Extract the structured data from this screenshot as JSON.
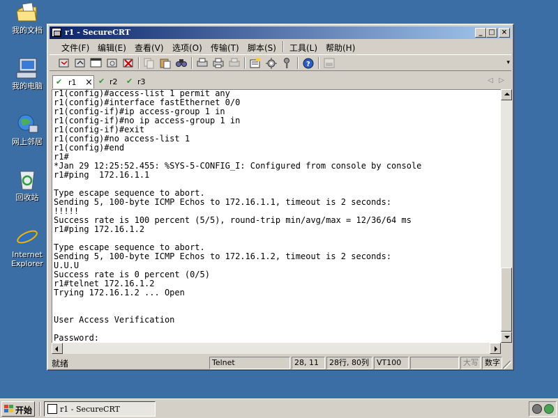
{
  "desktop": {
    "icons": [
      {
        "label": "我的文档",
        "icon": "folder-documents-icon"
      },
      {
        "label": "我的电脑",
        "icon": "computer-icon"
      },
      {
        "label": "网上邻居",
        "icon": "network-icon"
      },
      {
        "label": "回收站",
        "icon": "recycle-bin-icon"
      },
      {
        "label": "Internet Explorer",
        "icon": "internet-explorer-icon"
      }
    ]
  },
  "window": {
    "title": "r1 - SecureCRT",
    "controls": {
      "minimize": "_",
      "maximize": "□",
      "close": "×"
    },
    "menu": [
      "文件(F)",
      "编辑(E)",
      "查看(V)",
      "选项(O)",
      "传输(T)",
      "脚本(S)",
      "工具(L)",
      "帮助(H)"
    ],
    "tabs": [
      {
        "label": "r1",
        "active": true,
        "close": "×"
      },
      {
        "label": "r2",
        "active": false
      },
      {
        "label": "r3",
        "active": false
      }
    ],
    "tab_nav": {
      "prev": "◁",
      "next": "▷"
    },
    "terminal_lines": [
      "r1(config)#access-list 1 permit any",
      "r1(config)#interface fastEthernet 0/0",
      "r1(config-if)#ip access-group 1 in",
      "r1(config-if)#no ip access-group 1 in",
      "r1(config-if)#exit",
      "r1(config)#no access-list 1",
      "r1(config)#end",
      "r1#",
      "*Jan 29 12:25:52.455: %SYS-5-CONFIG_I: Configured from console by console",
      "r1#ping  172.16.1.1",
      "",
      "Type escape sequence to abort.",
      "Sending 5, 100-byte ICMP Echos to 172.16.1.1, timeout is 2 seconds:",
      "!!!!!",
      "Success rate is 100 percent (5/5), round-trip min/avg/max = 12/36/64 ms",
      "r1#ping 172.16.1.2",
      "",
      "Type escape sequence to abort.",
      "Sending 5, 100-byte ICMP Echos to 172.16.1.2, timeout is 2 seconds:",
      "U.U.U",
      "Success rate is 0 percent (0/5)",
      "r1#telnet 172.16.1.2",
      "Trying 172.16.1.2 ... Open",
      "",
      "",
      "User Access Verification",
      "",
      "Password:"
    ],
    "status": {
      "ready": "就绪",
      "protocol": "Telnet",
      "cursor_pos": "28, 11",
      "size": "28行, 80列",
      "terminal_type": "VT100",
      "caps": "大写",
      "num": "数字"
    }
  },
  "taskbar": {
    "start_label": "开始",
    "task_label": "r1 - SecureCRT"
  }
}
